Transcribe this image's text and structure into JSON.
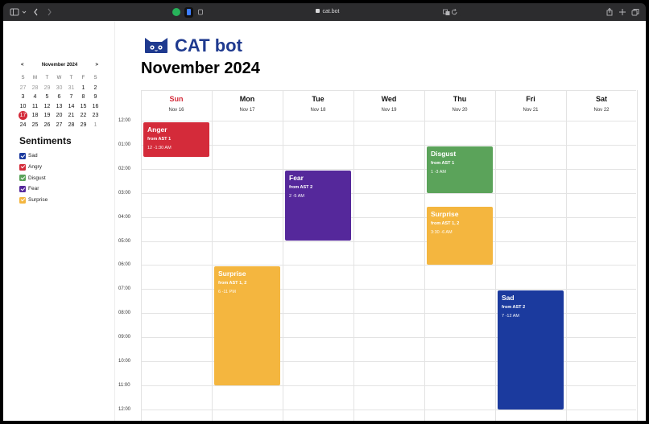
{
  "browser": {
    "url": "cat.bot",
    "sidebar_toggle_icon": "sidebar-icon",
    "back_icon": "chevron-left-icon",
    "forward_icon": "chevron-right-icon",
    "share_icon": "share-icon",
    "new_tab_icon": "plus-icon",
    "tabs_icon": "tabs-icon"
  },
  "header": {
    "brand": "CAT bot",
    "title": "November 2024"
  },
  "mini_calendar": {
    "prev": "<",
    "next": ">",
    "title": "November 2024",
    "weekdays": [
      "S",
      "M",
      "T",
      "W",
      "T",
      "F",
      "S"
    ],
    "weeks": [
      [
        "27",
        "28",
        "29",
        "30",
        "31",
        "1",
        "2"
      ],
      [
        "3",
        "4",
        "5",
        "6",
        "7",
        "8",
        "9"
      ],
      [
        "10",
        "11",
        "12",
        "13",
        "14",
        "15",
        "16"
      ],
      [
        "17",
        "18",
        "19",
        "20",
        "21",
        "22",
        "23"
      ],
      [
        "24",
        "25",
        "26",
        "27",
        "28",
        "29",
        "1"
      ]
    ],
    "today": "17"
  },
  "sentiments": {
    "title": "Sentiments",
    "items": [
      {
        "label": "Sad",
        "color": "#1b3a9e"
      },
      {
        "label": "Angry",
        "color": "#d42b3a"
      },
      {
        "label": "Disgust",
        "color": "#5ba35a"
      },
      {
        "label": "Fear",
        "color": "#55289b"
      },
      {
        "label": "Surprise",
        "color": "#f4b63f"
      }
    ]
  },
  "calendar": {
    "days": [
      {
        "name": "Sun",
        "date": "Nov 16",
        "highlight": true
      },
      {
        "name": "Mon",
        "date": "Nov 17"
      },
      {
        "name": "Tue",
        "date": "Nov 18"
      },
      {
        "name": "Wed",
        "date": "Nov 19"
      },
      {
        "name": "Thu",
        "date": "Nov 20"
      },
      {
        "name": "Fri",
        "date": "Nov 21"
      },
      {
        "name": "Sat",
        "date": "Nov 22"
      }
    ],
    "times": [
      "12:00",
      "01:00",
      "02:00",
      "03:00",
      "04:00",
      "05:00",
      "06:00",
      "07:00",
      "08:00",
      "09:00",
      "10:00",
      "11:00",
      "12:00"
    ],
    "events": [
      {
        "title": "Anger",
        "source": "from AST 1",
        "time": "12 -1:30 AM",
        "day": 0,
        "start": 0,
        "end": 1.5,
        "color": "#d42b3a"
      },
      {
        "title": "Fear",
        "source": "from AST 2",
        "time": "2 -5 AM",
        "day": 2,
        "start": 2,
        "end": 5,
        "color": "#55289b"
      },
      {
        "title": "Disgust",
        "source": "from AST 1",
        "time": "1 -3 AM",
        "day": 4,
        "start": 1,
        "end": 3,
        "color": "#5ba35a"
      },
      {
        "title": "Surprise",
        "source": "from AST 1, 2",
        "time": "3:30 -6 AM",
        "day": 4,
        "start": 3.5,
        "end": 6,
        "color": "#f4b63f"
      },
      {
        "title": "Surprise",
        "source": "from AST 1, 2",
        "time": "6 -11 PM",
        "day": 1,
        "start": 6,
        "end": 11,
        "color": "#f4b63f"
      },
      {
        "title": "Sad",
        "source": "from AST 2",
        "time": "7 -12 AM",
        "day": 5,
        "start": 7,
        "end": 12,
        "color": "#1b3a9e"
      }
    ]
  }
}
